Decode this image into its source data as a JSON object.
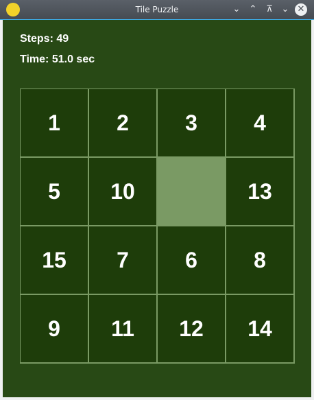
{
  "window": {
    "title": "Tile Puzzle"
  },
  "stats": {
    "steps": "Steps: 49",
    "time": "Time: 51.0 sec"
  },
  "board": [
    "1",
    "2",
    "3",
    "4",
    "5",
    "10",
    "",
    "13",
    "15",
    "7",
    "6",
    "8",
    "9",
    "11",
    "12",
    "14"
  ],
  "colors": {
    "background": "#284915",
    "tile": "#1e3d0a",
    "empty": "#7a9a64"
  }
}
